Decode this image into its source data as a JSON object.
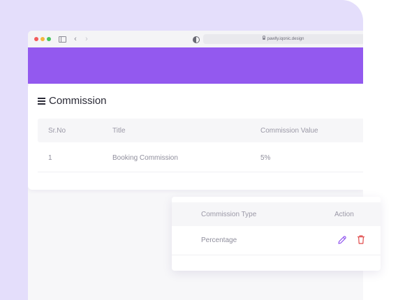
{
  "browser": {
    "url": "pawlly.iqonic.design"
  },
  "commission_card": {
    "title": "Commission",
    "columns": [
      "Sr.No",
      "Title",
      "Commission Value"
    ],
    "rows": [
      {
        "sr_no": "1",
        "title": "Booking Commission",
        "value": "5%"
      }
    ]
  },
  "detail_popup": {
    "columns": [
      "Commission Type",
      "Action"
    ],
    "rows": [
      {
        "type": "Percentage"
      }
    ]
  },
  "colors": {
    "accent": "#9359EF",
    "background_blob": "#E4DEFB",
    "delete": "#E04B4B"
  },
  "icons": [
    "sidebar-toggle-icon",
    "back-arrow-icon",
    "forward-arrow-icon",
    "shield-icon",
    "lock-icon",
    "hamburger-menu-icon",
    "edit-pencil-icon",
    "trash-icon"
  ]
}
